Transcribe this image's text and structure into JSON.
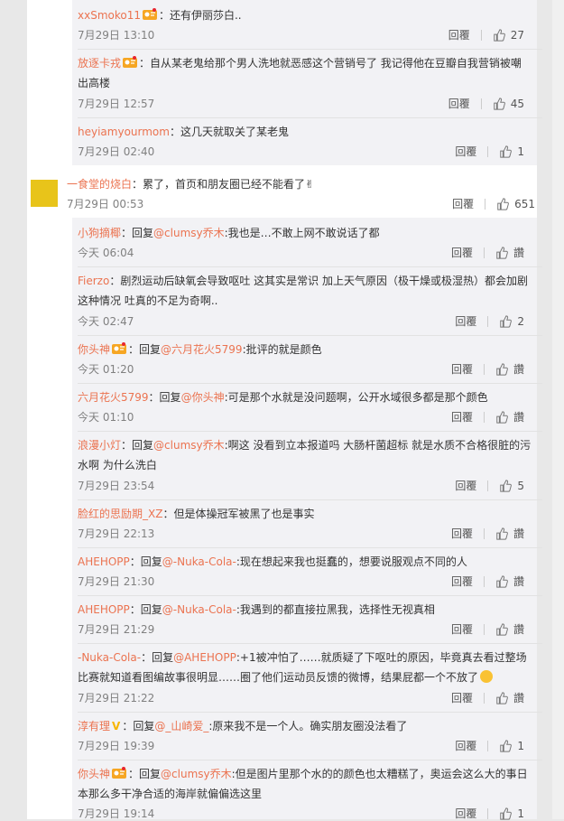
{
  "comments": [
    {
      "user": "xxSmoko11",
      "badge": "vip",
      "text": "：还有伊丽莎白..",
      "time": "7月29日 13:10",
      "reply": "回覆",
      "likes": "27"
    },
    {
      "user": "放逐卡戎",
      "badge": "vip",
      "text": "：自从某老鬼给那个男人洗地就恶感这个营销号了 我记得他在豆瓣自我营销被嘲",
      "text2": "出高楼",
      "time": "7月29日 12:57",
      "reply": "回覆",
      "likes": "45"
    },
    {
      "user": "heyiamyourmom",
      "text": "：这几天就取关了某老鬼",
      "time": "7月29日 02:40",
      "reply": "回覆",
      "likes": "1"
    },
    {
      "user": "一食堂的烧白",
      "text": "：累了，首页和朋友圈已经不能看了✌",
      "time": "7月29日 00:53",
      "reply": "回覆",
      "likes": "651"
    },
    {
      "user": "小狗摘椰",
      "text_pre": "：回复",
      "mention": "@clumsy乔木",
      "text": ":我也是…不敢上网不敢说话了都",
      "time": "今天 06:04",
      "reply": "回覆",
      "likes": "讚"
    },
    {
      "user": "Fierzo",
      "text": "：剧烈运动后缺氧会导致呕吐 这其实是常识 加上天气原因（极干燥或极湿热）都会加剧",
      "text2": "这种情况 吐真的不足为奇啊..",
      "time": "今天 02:47",
      "reply": "回覆",
      "likes": "2"
    },
    {
      "user": "你头神",
      "badge": "vip",
      "text_pre": "：回复",
      "mention": "@六月花火5799",
      "text": ":批评的就是颜色",
      "time": "今天 01:20",
      "reply": "回覆",
      "likes": "讚"
    },
    {
      "user": "六月花火5799",
      "text_pre": "：回复",
      "mention": "@你头神",
      "text": ":可是那个水就是没问题啊，公开水域很多都是那个颜色",
      "time": "今天 01:10",
      "reply": "回覆",
      "likes": "讚"
    },
    {
      "user": "浪漫小灯",
      "text_pre": "：回复",
      "mention": "@clumsy乔木",
      "text": ":啊这 没看到立本报道吗 大肠杆菌超标 就是水质不合格很脏的污",
      "text2": "水啊 为什么洗白",
      "time": "7月29日 23:54",
      "reply": "回覆",
      "likes": "5"
    },
    {
      "user": "脸红的思励期_XZ",
      "text": "：但是体操冠军被黑了也是事实",
      "time": "7月29日 22:13",
      "reply": "回覆",
      "likes": "讚"
    },
    {
      "user": "AHEHOPP",
      "text_pre": "：回复",
      "mention": "@-Nuka-Cola-",
      "text": ":现在想起来我也挺蠢的，想要说服观点不同的人",
      "time": "7月29日 21:30",
      "reply": "回覆",
      "likes": "讚"
    },
    {
      "user": "AHEHOPP",
      "text_pre": "：回复",
      "mention": "@-Nuka-Cola-",
      "text": ":我遇到的都直接拉黑我，选择性无视真相",
      "time": "7月29日 21:29",
      "reply": "回覆",
      "likes": "讚"
    },
    {
      "user": "-Nuka-Cola-",
      "text_pre": "：回复",
      "mention": "@AHEHOPP",
      "text": ":+1被冲怕了……就质疑了下呕吐的原因，毕竟真去看过整场",
      "text2": "比赛就知道看图编故事很明显……圈了他们运动员反馈的微博，结果屁都一个不放了",
      "time": "7月29日 21:22",
      "reply": "回覆",
      "likes": "讚"
    },
    {
      "user": "淳有理",
      "badge": "v",
      "text_pre": "：回复",
      "mention": "@_山崎爱_",
      "text": ":原来我不是一个人。确实朋友圈没法看了",
      "time": "7月29日 19:39",
      "reply": "回覆",
      "likes": "1"
    },
    {
      "user": "你头神",
      "badge": "vip",
      "text_pre": "：回复",
      "mention": "@clumsy乔木",
      "text": ":但是图片里那个水的的颜色也太糟糕了，奥运会这么大的事日",
      "text2": "本那么多干净合适的海岸就偏偏选这里",
      "time": "7月29日 19:14",
      "reply": "回覆",
      "likes": "1"
    }
  ]
}
